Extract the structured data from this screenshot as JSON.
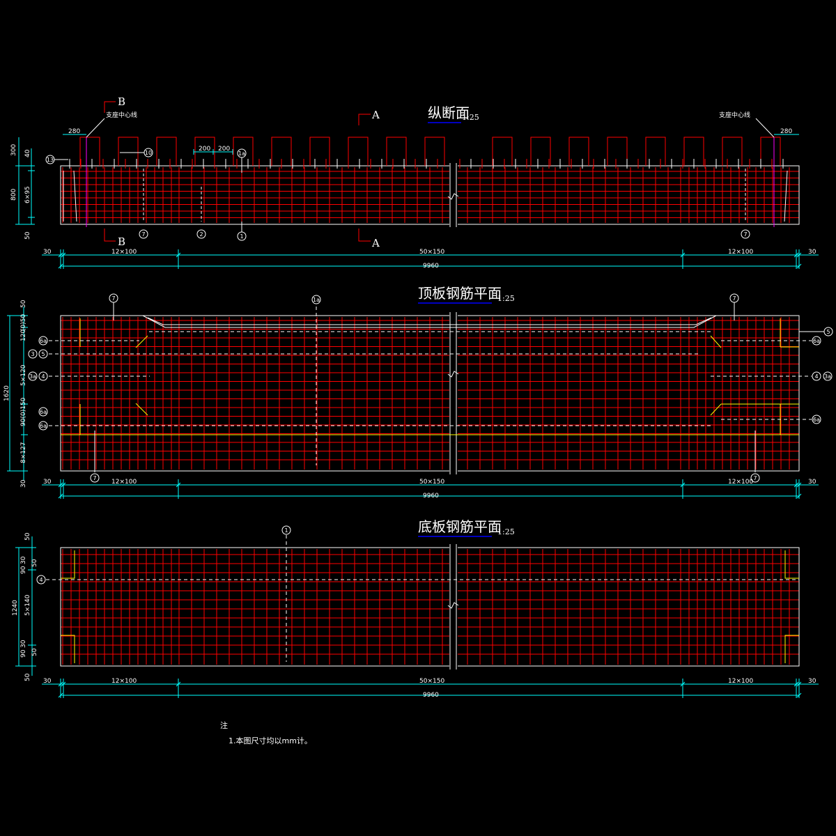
{
  "colors": {
    "background": "#000000",
    "rebar": "#ff0000",
    "outline": "#ffffff",
    "dimension": "#00ffff",
    "section_marker": "#ff0000",
    "support_line": "#ff00ff",
    "highlight": "#ffff00",
    "title_underline": "#0000ff"
  },
  "views": {
    "longitudinal": {
      "title": "纵断面",
      "scale": "1:25",
      "support_label_left": "支座中心线",
      "support_label_right": "支座中心线",
      "section_B": "B",
      "section_A": "A",
      "dim_end_left": "280",
      "dim_end_right": "280",
      "dim_spacing_1": "200",
      "dim_spacing_2": "200",
      "left_dims": [
        "300",
        "40",
        "800",
        "6×95",
        "50"
      ],
      "callouts": [
        "13",
        "10",
        "1a",
        "7",
        "2",
        "1",
        "7"
      ],
      "bottom_dims": [
        "30",
        "12×100",
        "50×150",
        "12×100",
        "30"
      ],
      "total": "9960"
    },
    "top_slab": {
      "title": "顶板钢筋平面",
      "scale": "1:25",
      "left_dims": [
        "50",
        "1620",
        "120",
        "(0)50",
        "5×120",
        "90(0)150",
        "8×127",
        "30"
      ],
      "top_callouts": [
        "7",
        "1a",
        "7"
      ],
      "left_callouts": [
        "6a",
        "3",
        "5",
        "3a",
        "4",
        "6a",
        "6a"
      ],
      "right_callouts": [
        "5",
        "6a",
        "4",
        "3a",
        "6a"
      ],
      "bottom_callouts": [
        "7",
        "7"
      ],
      "bottom_dims": [
        "30",
        "12×100",
        "50×150",
        "12×100",
        "30"
      ],
      "total": "9960"
    },
    "bottom_slab": {
      "title": "底板钢筋平面",
      "scale": "1:25",
      "left_dims": [
        "50",
        "1240",
        "30",
        "90",
        "50",
        "5×140",
        "30",
        "90",
        "50",
        "50"
      ],
      "callouts": [
        "1",
        "4"
      ],
      "bottom_dims": [
        "30",
        "12×100",
        "50×150",
        "12×100",
        "30"
      ],
      "total": "9960"
    }
  },
  "notes": {
    "heading": "注",
    "item1": "1.本图尺寸均以mm计。"
  }
}
